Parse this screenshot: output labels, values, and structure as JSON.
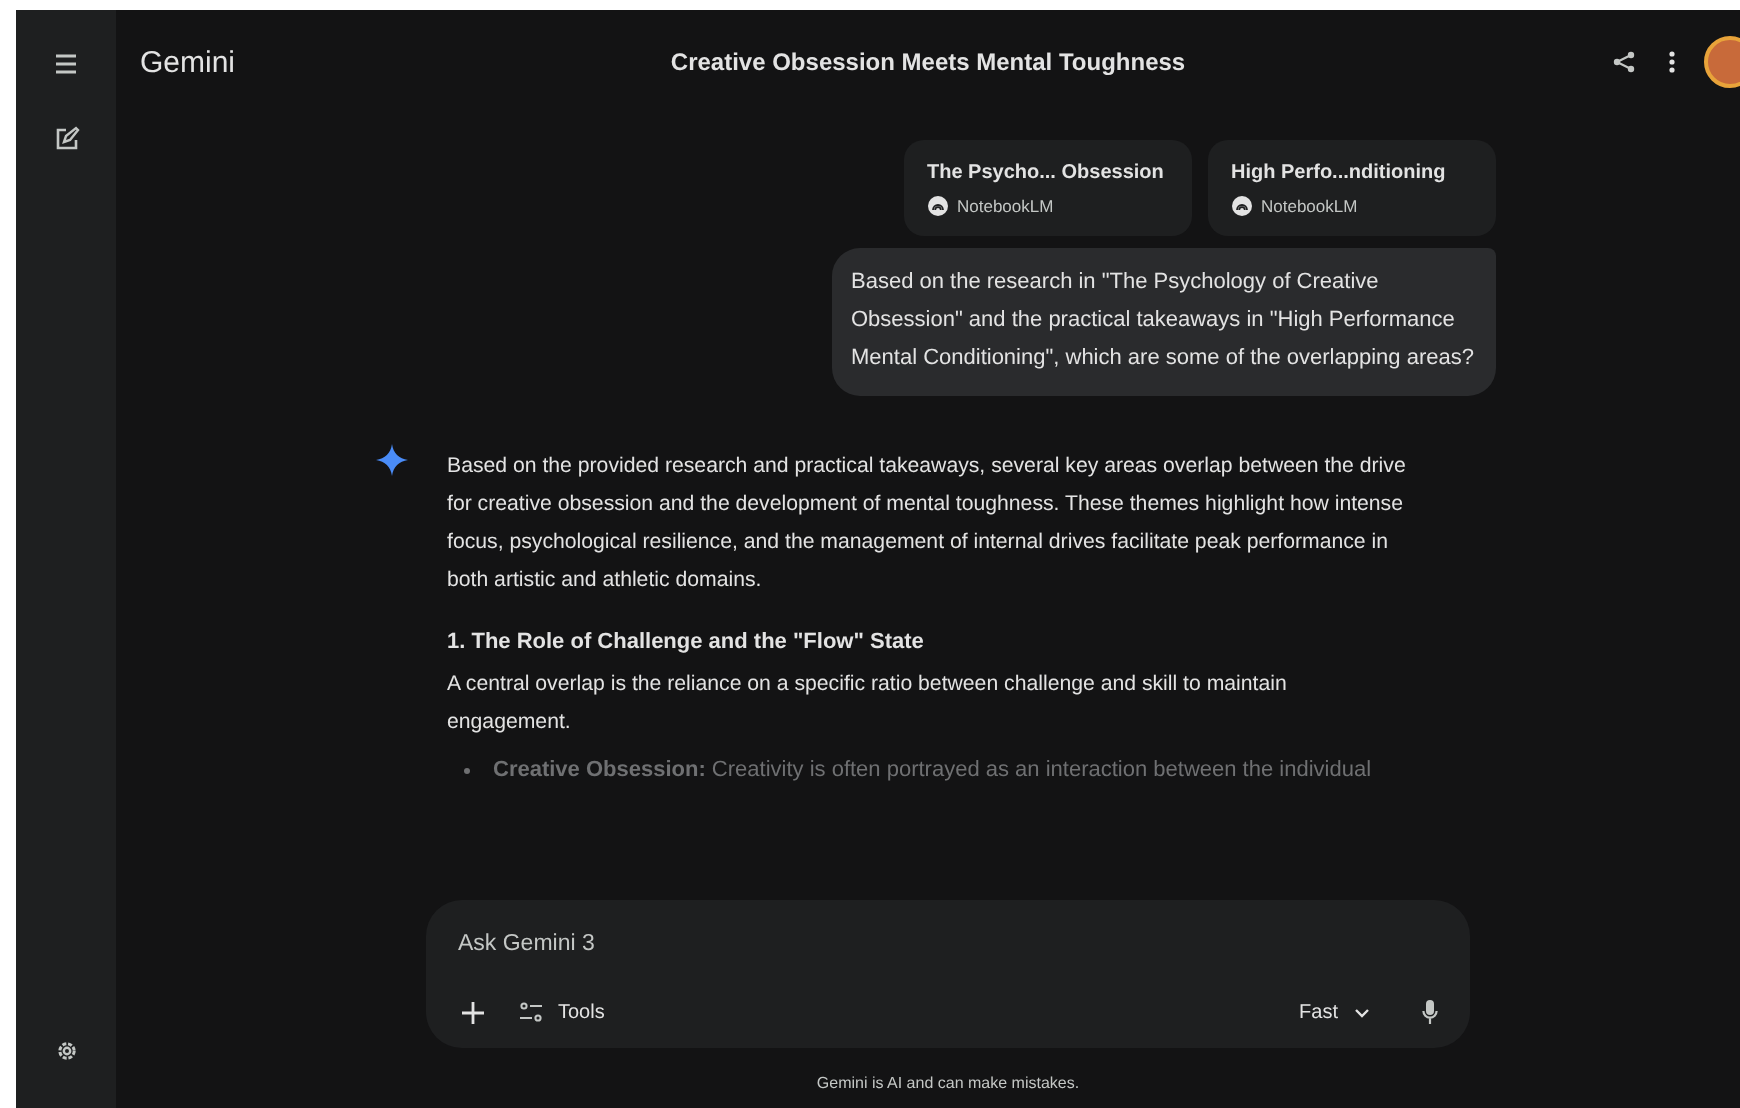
{
  "app": {
    "name": "Gemini"
  },
  "header": {
    "title": "Creative Obsession Meets Mental Toughness"
  },
  "sources": [
    {
      "title": "The Psycho... Obsession",
      "origin": "NotebookLM"
    },
    {
      "title": "High Perfo...nditioning",
      "origin": "NotebookLM"
    }
  ],
  "user_message": "Based on the research in \"The Psychology of Creative Obsession\" and the practical takeaways in \"High Performance Mental Conditioning\", which are some of the overlapping areas?",
  "response": [
    {
      "kind": "paragraph",
      "text": "Based on the provided research and practical takeaways, several key areas overlap between the drive for creative obsession and the development of mental toughness. These themes highlight how intense focus, psychological resilience, and the management of internal drives facilitate peak performance in both artistic and athletic domains."
    },
    {
      "kind": "heading",
      "text": "1. The Role of Challenge and the \"Flow\" State"
    },
    {
      "kind": "paragraph",
      "text": "A central overlap is the reliance on a specific ratio between challenge and skill to maintain engagement."
    },
    {
      "kind": "bullet",
      "text": "**Creative Obsession:** Creativity is often portrayed as an interaction between the individual"
    }
  ],
  "composer": {
    "placeholder": "Ask Gemini 3",
    "tools_label": "Tools",
    "mode": "Fast"
  },
  "disclaimer": "Gemini is AI and can make mistakes."
}
